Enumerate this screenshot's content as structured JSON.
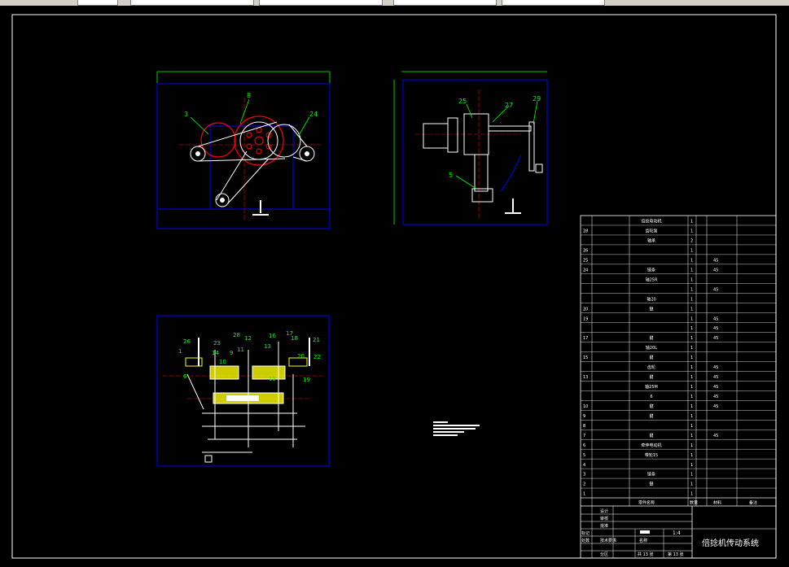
{
  "title_block": {
    "drawing_title": "倍捻机传动系统",
    "scale": "1:4",
    "sheet_total": "共 13 张",
    "sheet_no": "第 13 张",
    "row_labels": [
      "设计",
      "审核",
      "批准",
      "标记",
      "处数",
      "分区"
    ],
    "tech_label": "技术要求",
    "name_label": "名称",
    "material_header": "材料",
    "note_header": "备注",
    "part_header": "零件名称",
    "qty_header": "数量"
  },
  "bom_rows": [
    {
      "no": "",
      "name": "倍捻电动机",
      "qty": "1",
      "mat": ""
    },
    {
      "no": "28",
      "name": "齿轮泵",
      "qty": "1",
      "mat": ""
    },
    {
      "no": "",
      "name": "轴承",
      "qty": "2",
      "mat": ""
    },
    {
      "no": "26",
      "name": "",
      "qty": "1",
      "mat": ""
    },
    {
      "no": "25",
      "name": "",
      "qty": "1",
      "mat": "45"
    },
    {
      "no": "24",
      "name": "链条",
      "qty": "1",
      "mat": "45"
    },
    {
      "no": "",
      "name": "轴25R",
      "qty": "1",
      "mat": ""
    },
    {
      "no": "",
      "name": "",
      "qty": "1",
      "mat": "45"
    },
    {
      "no": "",
      "name": "轴20",
      "qty": "1",
      "mat": ""
    },
    {
      "no": "20",
      "name": "键",
      "qty": "1",
      "mat": ""
    },
    {
      "no": "19",
      "name": "",
      "qty": "1",
      "mat": "45"
    },
    {
      "no": "",
      "name": "",
      "qty": "1",
      "mat": "45"
    },
    {
      "no": "17",
      "name": "键",
      "qty": "1",
      "mat": "45"
    },
    {
      "no": "",
      "name": "轴20L",
      "qty": "1",
      "mat": ""
    },
    {
      "no": "15",
      "name": "键",
      "qty": "1",
      "mat": ""
    },
    {
      "no": "",
      "name": "齿轮",
      "qty": "1",
      "mat": "45"
    },
    {
      "no": "13",
      "name": "键",
      "qty": "1",
      "mat": "45"
    },
    {
      "no": "",
      "name": "轴25M",
      "qty": "1",
      "mat": "45"
    },
    {
      "no": "",
      "name": "6",
      "qty": "1",
      "mat": "45"
    },
    {
      "no": "10",
      "name": "键",
      "qty": "1",
      "mat": "45"
    },
    {
      "no": "9",
      "name": "键",
      "qty": "1",
      "mat": ""
    },
    {
      "no": "8",
      "name": "",
      "qty": "1",
      "mat": ""
    },
    {
      "no": "7",
      "name": "键",
      "qty": "1",
      "mat": "45"
    },
    {
      "no": "6",
      "name": "牵伸电动机",
      "qty": "1",
      "mat": ""
    },
    {
      "no": "5",
      "name": "带轮15",
      "qty": "1",
      "mat": ""
    },
    {
      "no": "4",
      "name": "",
      "qty": "1",
      "mat": ""
    },
    {
      "no": "3",
      "name": "链条",
      "qty": "1",
      "mat": ""
    },
    {
      "no": "2",
      "name": "键",
      "qty": "1",
      "mat": ""
    },
    {
      "no": "1",
      "name": "",
      "qty": "1",
      "mat": ""
    }
  ],
  "front_view_labels": [
    "3",
    "8",
    "24"
  ],
  "side_view_labels": [
    "25",
    "27",
    "29",
    "5"
  ],
  "plan_view_labels": [
    "26",
    "1",
    "23",
    "14",
    "9",
    "28",
    "12",
    "11",
    "13",
    "16",
    "17",
    "18",
    "21",
    "20",
    "22",
    "10",
    "6",
    "15",
    "19"
  ],
  "colors": {
    "frame": "#ffffff",
    "view_border": "#0000ff",
    "dim_lines": "#00ff00",
    "leaders": "#00ff00",
    "center_lines": "#ff0000",
    "parts_yellow": "#ffff00",
    "parts_white": "#ffffff"
  }
}
